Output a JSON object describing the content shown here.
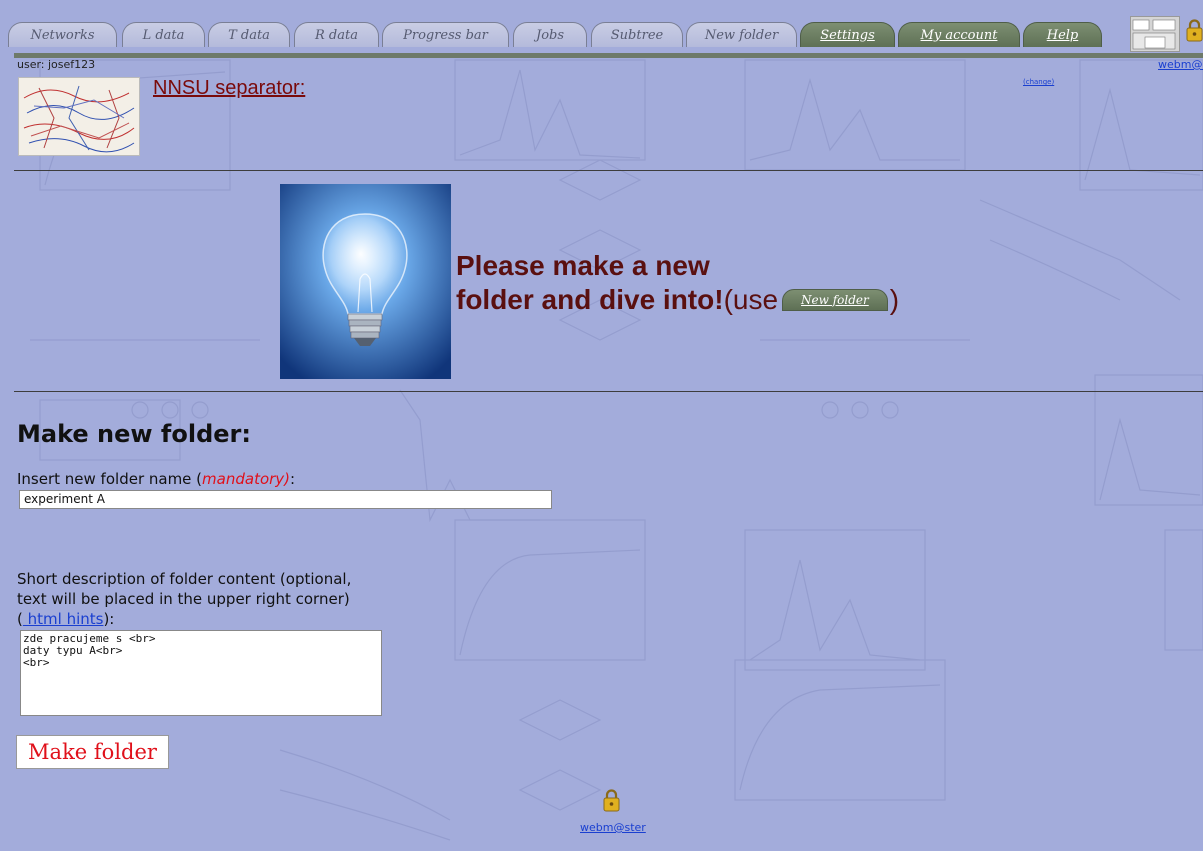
{
  "tabs": [
    {
      "label": "Networks"
    },
    {
      "label": "L data"
    },
    {
      "label": "T data"
    },
    {
      "label": "R data"
    },
    {
      "label": "Progress bar"
    },
    {
      "label": "Jobs"
    },
    {
      "label": "Subtree"
    },
    {
      "label": "New folder"
    },
    {
      "label": "Settings"
    },
    {
      "label": "My account"
    },
    {
      "label": "Help"
    }
  ],
  "header": {
    "user_text": "user: josef123",
    "webmaster_link": "webm@ster",
    "separator_link": "NNSU separator:",
    "change_link": "(change)"
  },
  "banner": {
    "line1": "Please make a new",
    "line2": "folder and dive into!",
    "use_prefix": "(use",
    "new_folder_tab": "New folder",
    "use_suffix": ")"
  },
  "form": {
    "heading": "Make new folder:",
    "name_label_prefix": "Insert new folder name (",
    "name_label_mandatory": "mandatory)",
    "name_label_suffix": ":",
    "name_value": "experiment A",
    "desc_label_line1": "Short description of folder content (optional,",
    "desc_label_line2": "text will be placed in the upper right corner)",
    "desc_label_open": "(",
    "desc_hints_link": " html hints",
    "desc_label_close": "):",
    "desc_value": "zde pracujeme s <br>\ndaty typu A<br>\n<br>",
    "submit_label": "Make folder"
  },
  "footer": {
    "webmaster_link": "webm@ster"
  },
  "colors": {
    "background": "#a3acdb",
    "active_tab": "#6e8064",
    "accent_red": "#e0101a",
    "banner_text": "#5a1010",
    "link": "#1a3fd0"
  },
  "icons": [
    "lock-icon",
    "toolbar-thumbnail-icon",
    "lightbulb-image",
    "network-logo-image"
  ]
}
